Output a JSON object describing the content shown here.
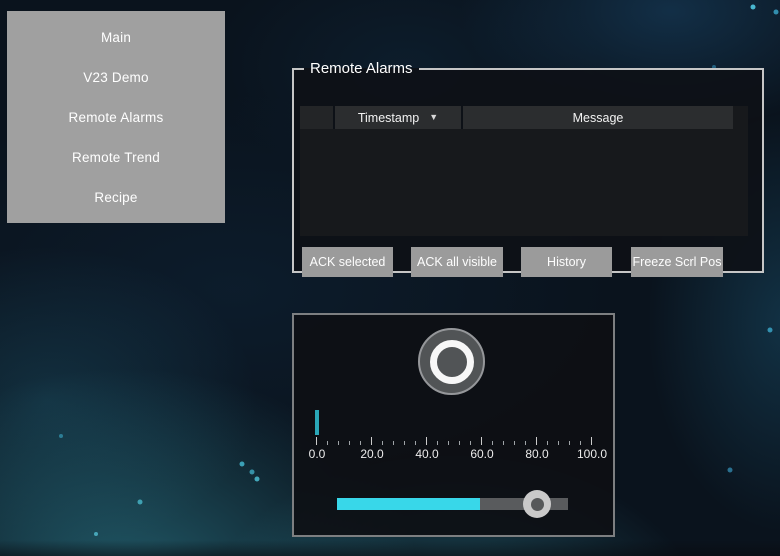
{
  "sidebar": {
    "items": [
      {
        "label": "Main"
      },
      {
        "label": "V23 Demo"
      },
      {
        "label": "Remote Alarms"
      },
      {
        "label": "Remote Trend"
      },
      {
        "label": "Recipe"
      }
    ]
  },
  "alarms_panel": {
    "title": "Remote Alarms",
    "table": {
      "columns": [
        {
          "label": ""
        },
        {
          "label": "Timestamp",
          "sort": "descending",
          "sort_icon": "▼"
        },
        {
          "label": "Message"
        }
      ],
      "rows": []
    },
    "buttons": [
      {
        "label": "ACK selected"
      },
      {
        "label": "ACK all visible"
      },
      {
        "label": "History"
      },
      {
        "label": "Freeze Scrl Pos"
      }
    ]
  },
  "control_panel": {
    "round_button": {
      "name": "round push button"
    },
    "gauge": {
      "value": 0.0,
      "min": 0.0,
      "max": 100.0,
      "tick_labels": [
        "0.0",
        "20.0",
        "40.0",
        "60.0",
        "80.0",
        "100.0"
      ]
    },
    "slider": {
      "value": 62,
      "min": 0,
      "max": 100
    }
  },
  "colors": {
    "accent_cyan": "#38d7e9",
    "gauge_teal": "#2aa7b8",
    "sidebar_gray": "#a0a0a0",
    "button_gray": "#9b9b9b",
    "panel_border_light": "#c6c6c6",
    "panel_border_dark": "#7d7f81",
    "background_navy": "#0a131d"
  }
}
